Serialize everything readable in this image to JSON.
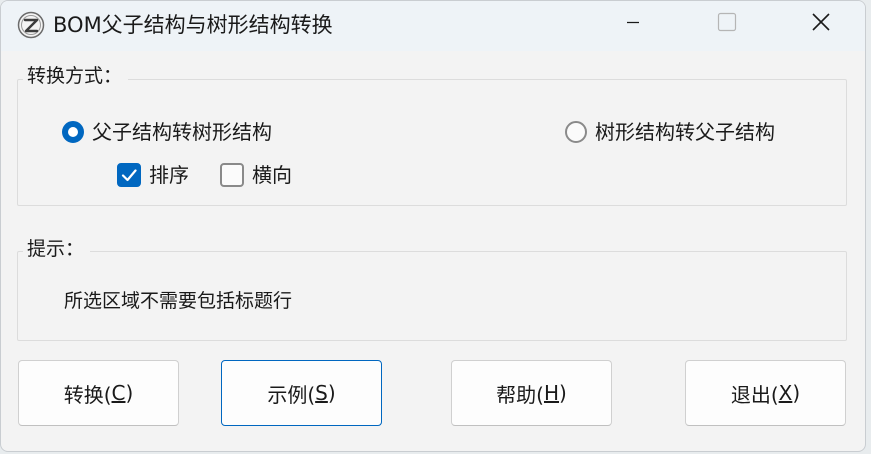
{
  "window": {
    "title": "BOM父子结构与树形结构转换",
    "minimize_icon": "minimize-icon",
    "maximize_icon": "maximize-icon",
    "close_icon": "close-icon"
  },
  "conversion": {
    "group_label": "转换方式：",
    "option_parent_child_to_tree": {
      "label": "父子结构转树形结构",
      "selected": true
    },
    "option_tree_to_parent_child": {
      "label": "树形结构转父子结构",
      "selected": false
    },
    "sort": {
      "label": "排序",
      "checked": true
    },
    "horizontal": {
      "label": "横向",
      "checked": false
    }
  },
  "hint": {
    "group_label": "提示：",
    "text": "所选区域不需要包括标题行"
  },
  "buttons": {
    "convert": {
      "text": "转换(",
      "mnemonic": "C",
      "close": ")"
    },
    "example": {
      "text": "示例(",
      "mnemonic": "S",
      "close": ")"
    },
    "help": {
      "text": "帮助(",
      "mnemonic": "H",
      "close": ")"
    },
    "exit": {
      "text": "退出(",
      "mnemonic": "X",
      "close": ")"
    }
  },
  "colors": {
    "accent": "#0067c0",
    "window_bg": "#f3f3f3",
    "titlebar_bg": "#eef3f7"
  }
}
